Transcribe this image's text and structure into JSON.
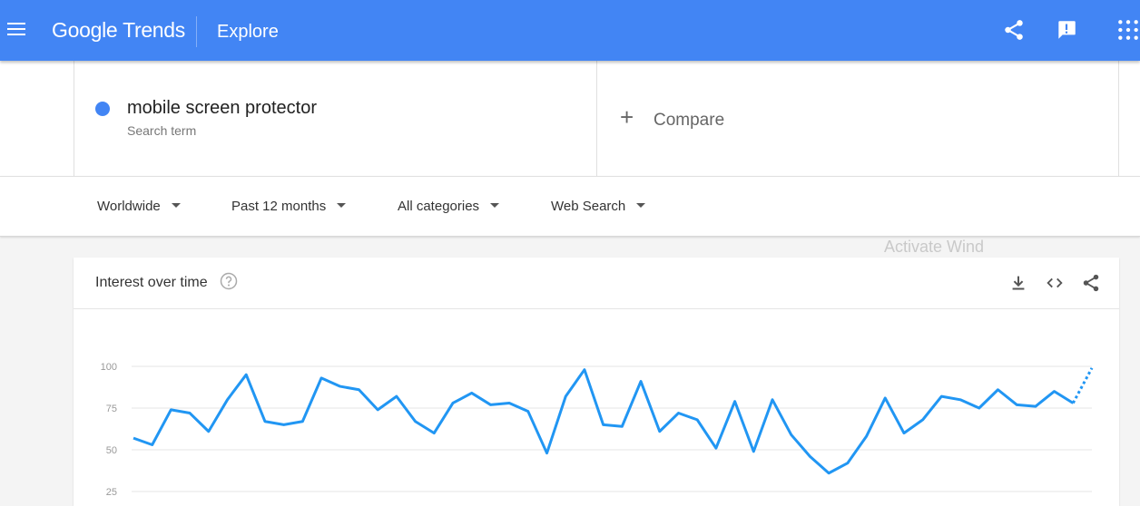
{
  "header": {
    "logo_google": "Google",
    "logo_trends": "Trends",
    "page_title": "Explore",
    "bar_color": "#4285f4",
    "icons": [
      "menu-icon",
      "share-icon",
      "feedback-icon",
      "apps-icon"
    ]
  },
  "search": {
    "term": "mobile screen protector",
    "term_sub": "Search term",
    "term_color": "#4285f4",
    "compare_label": "Compare"
  },
  "filters": {
    "region": "Worldwide",
    "time": "Past 12 months",
    "category": "All categories",
    "property": "Web Search"
  },
  "card": {
    "title": "Interest over time",
    "icons": [
      "help-icon",
      "download-icon",
      "embed-icon",
      "share-icon"
    ]
  },
  "watermark": "Activate Wind",
  "chart_data": {
    "type": "line",
    "series": [
      {
        "color": "#2196f3",
        "values": [
          57,
          53,
          74,
          72,
          61,
          80,
          95,
          67,
          65,
          67,
          93,
          88,
          86,
          74,
          82,
          67,
          60,
          78,
          84,
          77,
          78,
          73,
          48,
          82,
          98,
          65,
          64,
          91,
          61,
          72,
          68,
          51,
          79,
          49,
          80,
          59,
          46,
          36,
          42,
          58,
          81,
          60,
          68,
          82,
          80,
          75,
          86,
          77,
          76,
          85,
          78,
          99
        ],
        "partial_from_index": 50
      }
    ],
    "y_ticks": [
      100,
      75,
      50,
      25
    ],
    "ylim": [
      0,
      100
    ],
    "grid": true
  }
}
